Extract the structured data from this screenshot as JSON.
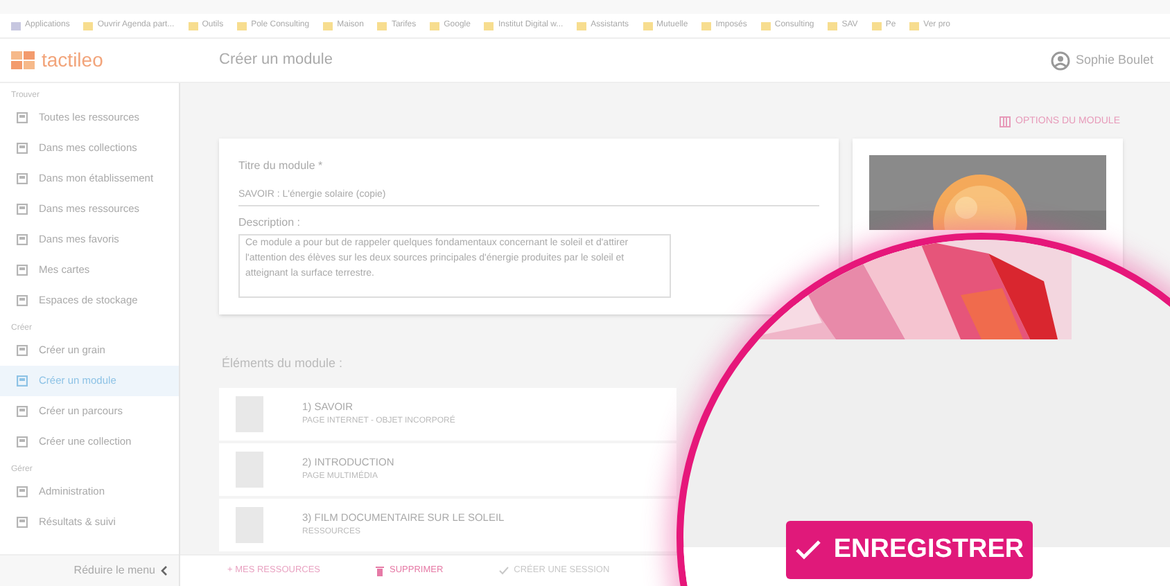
{
  "bookmarks": [
    {
      "label": "Applications"
    },
    {
      "label": "Ouvrir Agenda part..."
    },
    {
      "label": "Outils"
    },
    {
      "label": "Pole Consulting"
    },
    {
      "label": "Maison"
    },
    {
      "label": "Tarifes"
    },
    {
      "label": "Google"
    },
    {
      "label": "Institut Digital w..."
    },
    {
      "label": "Assistants"
    },
    {
      "label": "Mutuelle"
    },
    {
      "label": "Imposés"
    },
    {
      "label": "Consulting"
    },
    {
      "label": "SAV"
    },
    {
      "label": "Pe"
    },
    {
      "label": "Ver pro"
    }
  ],
  "header": {
    "logo": "tactileo",
    "page_title": "Créer un module",
    "user": "Sophie Boulet"
  },
  "sidebar": {
    "sections": [
      {
        "heading": "Trouver",
        "items": [
          {
            "label": "Toutes les ressources",
            "selected": false
          },
          {
            "label": "Dans mes collections",
            "selected": false
          },
          {
            "label": "Dans mon établissement",
            "selected": false
          },
          {
            "label": "Dans mes ressources",
            "selected": false
          },
          {
            "label": "Dans mes favoris",
            "selected": false
          },
          {
            "label": "Mes cartes",
            "selected": false
          },
          {
            "label": "Espaces de stockage",
            "selected": false
          }
        ]
      },
      {
        "heading": "Créer",
        "items": [
          {
            "label": "Créer un grain",
            "selected": false
          },
          {
            "label": "Créer un module",
            "selected": true
          },
          {
            "label": "Créer un parcours",
            "selected": false
          },
          {
            "label": "Créer une collection",
            "selected": false
          }
        ]
      },
      {
        "heading": "Gérer",
        "items": [
          {
            "label": "Administration",
            "selected": false
          },
          {
            "label": "Résultats & suivi",
            "selected": false
          }
        ]
      }
    ],
    "collapse": "Réduire le menu"
  },
  "options_link": "OPTIONS DU MODULE",
  "form": {
    "title_label": "Titre du module *",
    "title_value": "SAVOIR : L'énergie solaire (copie)",
    "description_label": "Description :",
    "description_value": "Ce module a pour but de rappeler quelques fondamentaux concernant le soleil et d'attirer l'attention des élèves sur les deux sources principales d'énergie produites par le soleil et atteignant la surface terrestre."
  },
  "elements": {
    "heading": "Éléments du module :",
    "items": [
      {
        "title": "1) SAVOIR",
        "subtitle": "PAGE INTERNET - OBJET INCORPORÉ"
      },
      {
        "title": "2) INTRODUCTION",
        "subtitle": "PAGE MULTIMÉDIA"
      },
      {
        "title": "3) FILM DOCUMENTAIRE SUR LE SOLEIL",
        "subtitle": "RESSOURCES"
      }
    ]
  },
  "actions": [
    {
      "label": "+ MES RESSOURCES",
      "kind": "add"
    },
    {
      "label": "SUPPRIMER",
      "kind": "delete"
    },
    {
      "label": "CRÉER UNE SESSION",
      "kind": "session"
    }
  ],
  "save_button": "ENREGISTRER"
}
